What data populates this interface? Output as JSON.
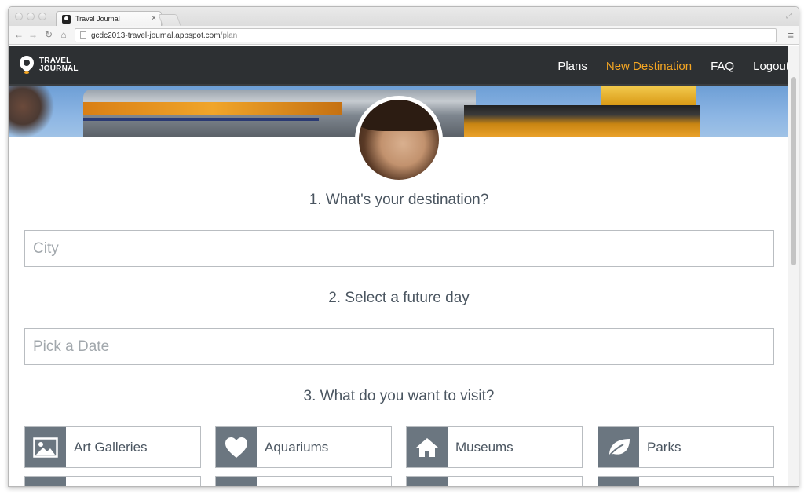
{
  "browser": {
    "tab_title": "Travel Journal",
    "tab_close": "×",
    "url_host": "gcdc2013-travel-journal.appspot.com",
    "url_path": "/plan"
  },
  "navbar": {
    "logo_line1": "TRAVEL",
    "logo_line2": "JOURNAL",
    "links": [
      {
        "label": "Plans",
        "active": false
      },
      {
        "label": "New Destination",
        "active": true
      },
      {
        "label": "FAQ",
        "active": false
      },
      {
        "label": "Logout",
        "active": false
      }
    ],
    "accent_color": "#f5a623",
    "bg_color": "#2d3033"
  },
  "form": {
    "step1_title": "1. What's your destination?",
    "city_placeholder": "City",
    "step2_title": "2. Select a future day",
    "date_placeholder": "Pick a Date",
    "step3_title": "3. What do you want to visit?"
  },
  "categories": [
    {
      "label": "Art Galleries",
      "icon": "image-icon"
    },
    {
      "label": "Aquariums",
      "icon": "heart-icon"
    },
    {
      "label": "Museums",
      "icon": "home-icon"
    },
    {
      "label": "Parks",
      "icon": "leaf-icon"
    }
  ]
}
